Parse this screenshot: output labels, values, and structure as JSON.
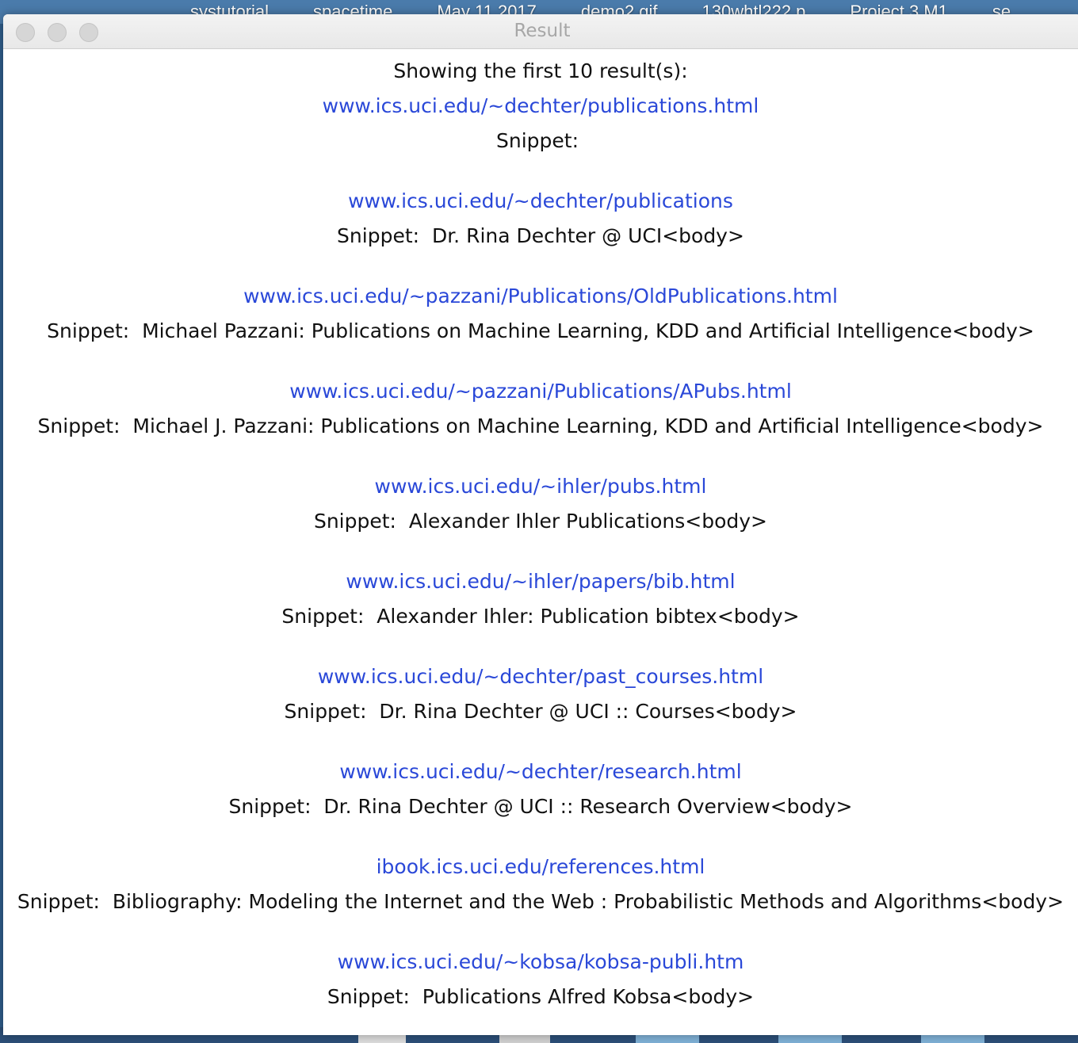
{
  "desktop": {
    "labels": [
      "systutorial",
      "spacetime",
      "May 11 2017",
      "demo2.gif",
      "130whtl222.p",
      "Project 3 M1",
      "se"
    ]
  },
  "window": {
    "title": "Result"
  },
  "results": {
    "header": "Showing the first 10 result(s):",
    "items": [
      {
        "url": "www.ics.uci.edu/~dechter/publications.html",
        "snippet": "Snippet: "
      },
      {
        "url": "www.ics.uci.edu/~dechter/publications",
        "snippet": "Snippet:  Dr. Rina Dechter @ UCI<body>"
      },
      {
        "url": "www.ics.uci.edu/~pazzani/Publications/OldPublications.html",
        "snippet": "Snippet:  Michael Pazzani: Publications on Machine Learning, KDD and Artificial Intelligence<body>"
      },
      {
        "url": "www.ics.uci.edu/~pazzani/Publications/APubs.html",
        "snippet": "Snippet:  Michael J. Pazzani: Publications on Machine Learning, KDD and Artificial Intelligence<body>"
      },
      {
        "url": "www.ics.uci.edu/~ihler/pubs.html",
        "snippet": "Snippet:  Alexander Ihler Publications<body>"
      },
      {
        "url": "www.ics.uci.edu/~ihler/papers/bib.html",
        "snippet": "Snippet:  Alexander Ihler: Publication bibtex<body>"
      },
      {
        "url": "www.ics.uci.edu/~dechter/past_courses.html",
        "snippet": "Snippet:  Dr. Rina Dechter @ UCI :: Courses<body>"
      },
      {
        "url": "www.ics.uci.edu/~dechter/research.html",
        "snippet": "Snippet:  Dr. Rina Dechter @ UCI :: Research Overview<body>"
      },
      {
        "url": "ibook.ics.uci.edu/references.html",
        "snippet": "Snippet:  Bibliography: Modeling the Internet and the Web : Probabilistic Methods and Algorithms<body>"
      },
      {
        "url": "www.ics.uci.edu/~kobsa/kobsa-publi.htm",
        "snippet": "Snippet:  Publications Alfred Kobsa<body>"
      }
    ]
  },
  "colors": {
    "link": "#2a48d8",
    "text": "#111111",
    "title": "#a7a7a7"
  }
}
